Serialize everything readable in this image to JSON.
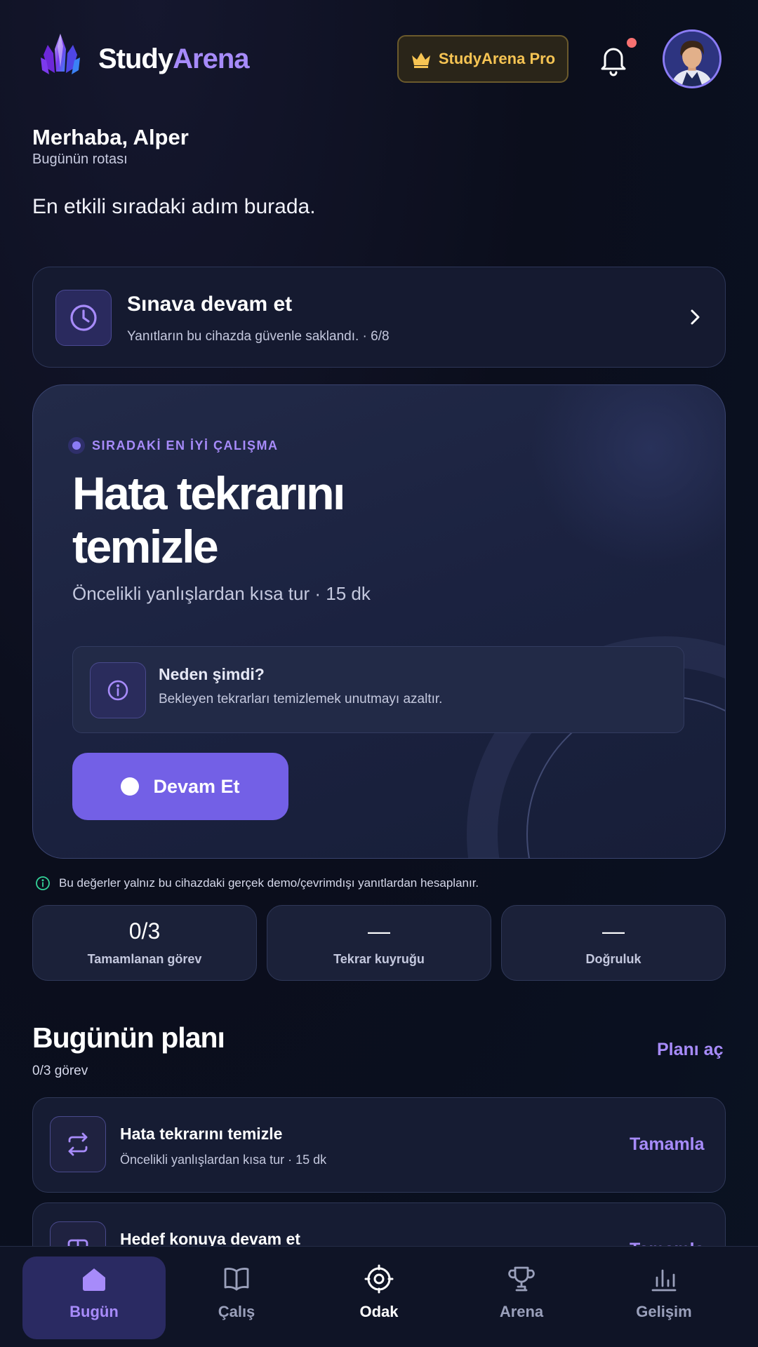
{
  "header": {
    "brand_part1": "Study",
    "brand_part2": "Arena",
    "pro_label": "StudyArena Pro"
  },
  "greeting": {
    "hello": "Merhaba, Alper",
    "route": "Bugünün rotası",
    "tagline": "En etkili sıradaki adım burada."
  },
  "resume_card": {
    "title": "Sınava devam et",
    "subtitle": "Yanıtların bu cihazda güvenle saklandı. · 6/8"
  },
  "hero": {
    "kicker": "SIRADAKİ EN İYİ ÇALIŞMA",
    "title_line1": "Hata tekrarını",
    "title_line2": "temizle",
    "subtitle": "Öncelikli yanlışlardan kısa tur · 15 dk",
    "why_title": "Neden şimdi?",
    "why_text": "Bekleyen tekrarları temizlemek unutmayı azaltır.",
    "cta_label": "Devam Et"
  },
  "note": "Bu değerler yalnız bu cihazdaki gerçek demo/çevrimdışı yanıtlardan hesaplanır.",
  "stats": [
    {
      "value": "0/3",
      "label": "Tamamlanan görev"
    },
    {
      "value": "—",
      "label": "Tekrar kuyruğu"
    },
    {
      "value": "—",
      "label": "Doğruluk"
    }
  ],
  "plan": {
    "title": "Bugünün planı",
    "count": "0/3 görev",
    "open_label": "Planı aç",
    "tasks": [
      {
        "title": "Hata tekrarını temizle",
        "subtitle": "Öncelikli yanlışlardan kısa tur · 15 dk",
        "action": "Tamamla"
      },
      {
        "title": "Hedef konuya devam et",
        "subtitle": "",
        "action": "Tamamla"
      }
    ]
  },
  "nav": [
    {
      "label": "Bugün",
      "icon": "home-icon"
    },
    {
      "label": "Çalış",
      "icon": "book-icon"
    },
    {
      "label": "Odak",
      "icon": "target-icon"
    },
    {
      "label": "Arena",
      "icon": "trophy-icon"
    },
    {
      "label": "Gelişim",
      "icon": "bar-chart-icon"
    }
  ],
  "colors": {
    "accent": "#a78bfa",
    "cta": "#7360e6",
    "pro_gold": "#f6c453",
    "notification": "#f87171",
    "info_green": "#34d399"
  }
}
